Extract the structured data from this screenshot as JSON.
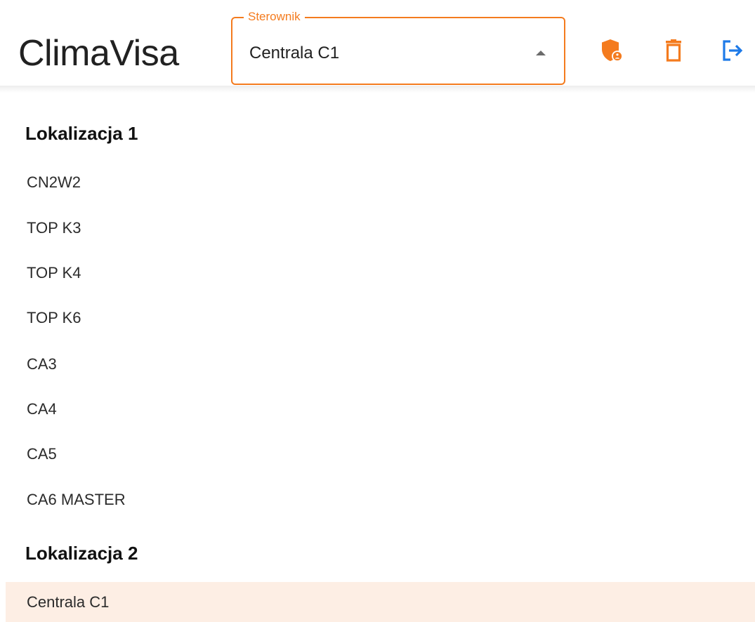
{
  "header": {
    "brand": "ClimaVisa",
    "select": {
      "label": "Sterownik",
      "value": "Centrala C1"
    },
    "accent_color": "#f47b1e",
    "logout_color": "#1e7ae8",
    "icons": [
      "admin-shield-icon",
      "trash-icon",
      "logout-icon"
    ]
  },
  "groups": [
    {
      "title": "Lokalizacja 1",
      "items": [
        {
          "label": "CN2W2"
        },
        {
          "label": "TOP K3"
        },
        {
          "label": "TOP K4"
        },
        {
          "label": "TOP K6"
        },
        {
          "label": "CA3"
        },
        {
          "label": "CA4"
        },
        {
          "label": "CA5"
        },
        {
          "label": "CA6 MASTER"
        }
      ]
    },
    {
      "title": "Lokalizacja 2",
      "items": [
        {
          "label": "Centrala C1",
          "selected": true
        }
      ]
    }
  ]
}
